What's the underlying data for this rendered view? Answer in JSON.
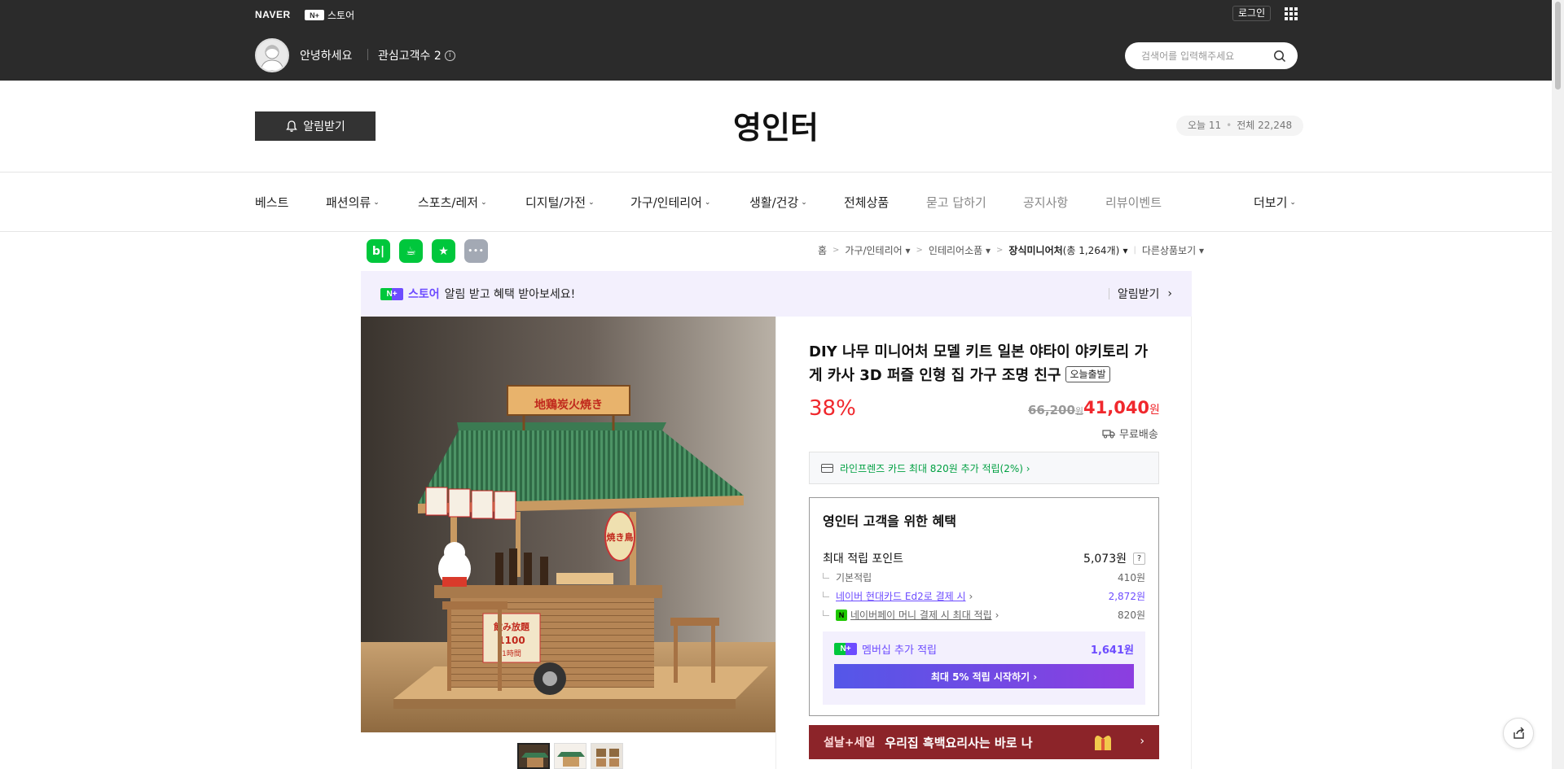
{
  "topbar": {
    "naver_logo": "NAVER",
    "np_badge": "N+",
    "store_label": "스토어",
    "login": "로그인",
    "greeting": "안녕하세요",
    "follower_label": "관심고객수 2",
    "info_glyph": "i",
    "search_placeholder": "검색어를 입력해주세요"
  },
  "store": {
    "alarm_button": "알림받기",
    "name": "영인터",
    "visitors_today": "오늘 11",
    "visitors_dot": "•",
    "visitors_total": "전체 22,248"
  },
  "nav": {
    "items": [
      {
        "label": "베스트"
      },
      {
        "label": "패션의류"
      },
      {
        "label": "스포츠/레저"
      },
      {
        "label": "디지털/가전"
      },
      {
        "label": "가구/인테리어"
      },
      {
        "label": "생활/건강"
      },
      {
        "label": "전체상품"
      },
      {
        "label": "묻고 답하기"
      },
      {
        "label": "공지사항"
      },
      {
        "label": "리뷰이벤트"
      }
    ],
    "more": "더보기",
    "chevron": "⌄"
  },
  "share_icons": [
    {
      "name": "blog",
      "glyph": "b|",
      "color": "#00c73c"
    },
    {
      "name": "cafe",
      "glyph": "☕",
      "color": "#00c73c"
    },
    {
      "name": "bookmark",
      "glyph": "★",
      "color": "#00c73c"
    },
    {
      "name": "more",
      "glyph": "•••",
      "color": "#a3a9b4"
    }
  ],
  "breadcrumb": {
    "home": "홈",
    "cat1": "가구/인테리어",
    "cat2": "인테리어소품",
    "cat3": "장식미니어처",
    "count": "(총 1,264개)",
    "other": "다른상품보기",
    "gt": ">",
    "caret": "▾"
  },
  "notify_banner": {
    "badge": "N+",
    "store": "스토어",
    "message": "알림 받고 혜택 받아보세요!",
    "action": "알림받기",
    "arrow": "›"
  },
  "product": {
    "title": "DIY 나무 미니어처 모델 키트 일본 야타이 야키토리 가게 카사 3D 퍼즐 인형 집 가구 조명 친구",
    "today_badge": "오늘출발",
    "discount": "38%",
    "original_price": "66,200",
    "original_unit": "원",
    "sale_price": "41,040",
    "sale_unit": "원",
    "shipping": "무료배송",
    "card_benefit": "라인프렌즈 카드 최대 820원 추가 적립(2%) ›",
    "sign_top": "地鶏炭火焼き",
    "sign_side": "焼き鳥",
    "sign_front": "飲み放題",
    "sign_price": "1100",
    "sign_price2": "1時間"
  },
  "benefits": {
    "title": "영인터 고객을 위한 혜택",
    "max_points_label": "최대 적립 포인트",
    "max_points_value": "5,073원",
    "help": "?",
    "rows": [
      {
        "label": "기본적립",
        "value": "410원"
      },
      {
        "label": "네이버 현대카드 Ed2로 결제 시",
        "value": "2,872원"
      },
      {
        "label": "네이버페이 머니 결제 시 최대 적립",
        "value": "820원"
      }
    ],
    "npay_glyph": "N",
    "link_arrow": "›",
    "membership_badge": "N+",
    "membership_label": "멤버십 추가 적립",
    "membership_value": "1,641원",
    "membership_button": "최대 5% 적립 시작하기 ›"
  },
  "sale_banner": {
    "tag": "설날+세일",
    "text": "우리집 흑백요리사는 바로 나",
    "arrow": "›"
  }
}
